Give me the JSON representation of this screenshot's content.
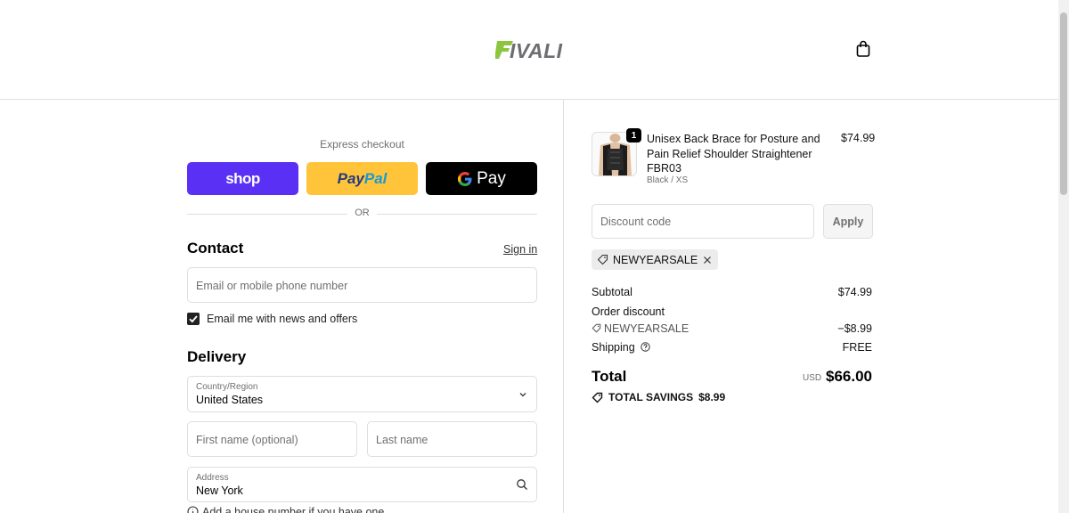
{
  "brand": {
    "logo_text": "FIVALI",
    "accent": "#8cc63f",
    "logo_gray": "#6d6e71"
  },
  "header": {
    "cart_icon": "bag-icon"
  },
  "express": {
    "label": "Express checkout",
    "shop_pay": "shop",
    "paypal_a": "Pay",
    "paypal_b": "Pal",
    "gpay": "Pay",
    "or": "OR"
  },
  "contact": {
    "title": "Contact",
    "sign_in": "Sign in",
    "email_placeholder": "Email or mobile phone number",
    "newsletter_label": "Email me with news and offers",
    "newsletter_checked": true
  },
  "delivery": {
    "title": "Delivery",
    "country_label": "Country/Region",
    "country_value": "United States",
    "first_name_placeholder": "First name (optional)",
    "last_name_placeholder": "Last name",
    "address_label": "Address",
    "address_value": "New York",
    "hint": "Add a house number if you have one"
  },
  "order": {
    "item": {
      "quantity": "1",
      "name": "Unisex Back Brace for Posture and Pain Relief Shoulder Straightener FBR03",
      "variant": "Black / XS",
      "price": "$74.99"
    },
    "discount_placeholder": "Discount code",
    "apply_label": "Apply",
    "applied_code": "NEWYEARSALE",
    "subtotal_label": "Subtotal",
    "subtotal_value": "$74.99",
    "order_discount_label": "Order discount",
    "discount_code_line": "NEWYEARSALE",
    "discount_value": "−$8.99",
    "shipping_label": "Shipping",
    "shipping_value": "FREE",
    "total_label": "Total",
    "currency": "USD",
    "total_value": "$66.00",
    "savings_label": "TOTAL SAVINGS",
    "savings_value": "$8.99"
  },
  "colors": {
    "shop_purple": "#5a31f4",
    "paypal_yellow": "#ffc439",
    "border": "#dedede"
  }
}
